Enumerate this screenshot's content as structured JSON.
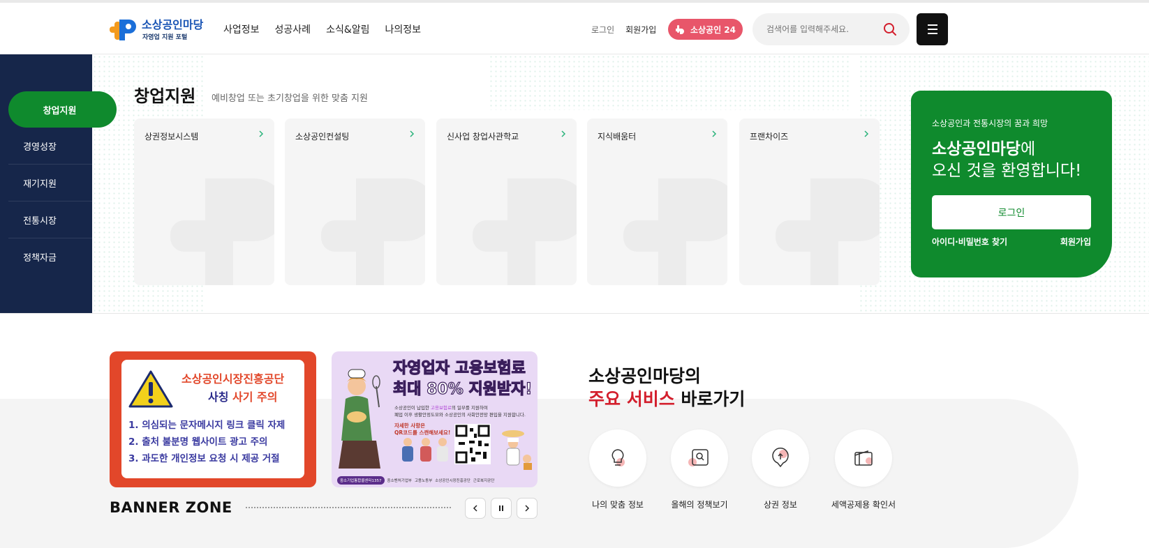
{
  "header": {
    "logo_title": "소상공인마당",
    "logo_sub": "자영업 지원 포털",
    "nav": [
      "사업정보",
      "성공사례",
      "소식&알림",
      "나의정보"
    ],
    "login": "로그인",
    "join": "회원가입",
    "pill": "소상공인 24",
    "search_placeholder": "검색어를 입력해주세요."
  },
  "sidenav": {
    "active": "창업지원",
    "items": [
      "경영성장",
      "재기지원",
      "전통시장",
      "정책자금"
    ]
  },
  "section": {
    "title": "창업지원",
    "subtitle": "예비창업 또는 초기창업을 위한 맞춤 지원",
    "cards": [
      "상권정보시스템",
      "소상공인컨설팅",
      "신사업 창업사관학교",
      "지식배움터",
      "프랜차이즈"
    ]
  },
  "welcome": {
    "sub": "소상공인과 전통시장의 꿈과 희망",
    "brand": "소상공인마당",
    "line1_suffix": "에",
    "line2": "오신 것을 환영합니다!",
    "login_button": "로그인",
    "find": "아이디·비밀번호 찾기",
    "join": "회원가입"
  },
  "banner1": {
    "title": "소상공인시장진흥공단",
    "title2_a": "사칭 ",
    "title2_b": "사기 주의",
    "lines": [
      "1. 의심되는 문자메시지 링크 클릭 자제",
      "2. 출처 불분명 웹사이트 광고 주의",
      "3. 과도한 개인정보 요청 시 제공 거절"
    ]
  },
  "banner2": {
    "title1": "자영업자 고용보험료",
    "title2": "최대 80% 지원받자!",
    "small_a": "소상공인이 납입한 ",
    "small_hl": "고용보험료",
    "small_b": "의 일부를 지원하여",
    "small2": "폐업 이후 생활안정도모와 소상공인의 사회안전망 편입을 지원합니다.",
    "qr_text1": "자세한 사항은",
    "qr_text2": "QR코드를 스캔해보세요!",
    "foot_tag": "중소기업통합콜센터1357",
    "foot_orgs": [
      "중소벤처기업부",
      "고용노동부",
      "소상공인시장진흥공단",
      "근로복지공단"
    ]
  },
  "banner_zone": {
    "title": "BANNER ZONE"
  },
  "services": {
    "title1": "소상공인마당의",
    "title2_red": "주요 서비스",
    "title2_rest": " 바로가기",
    "items": [
      {
        "label": "나의 맞춤 정보",
        "icon": "lightbulb-icon"
      },
      {
        "label": "올해의 정책보기",
        "icon": "policy-search-icon"
      },
      {
        "label": "상권 정보",
        "icon": "location-pin-icon"
      },
      {
        "label": "세액공제용 확인서",
        "icon": "wallet-icon"
      }
    ]
  },
  "colors": {
    "brand_green": "#0f8a2d",
    "navy": "#16264a",
    "pink": "#e8566a",
    "red": "#d31e2c"
  }
}
